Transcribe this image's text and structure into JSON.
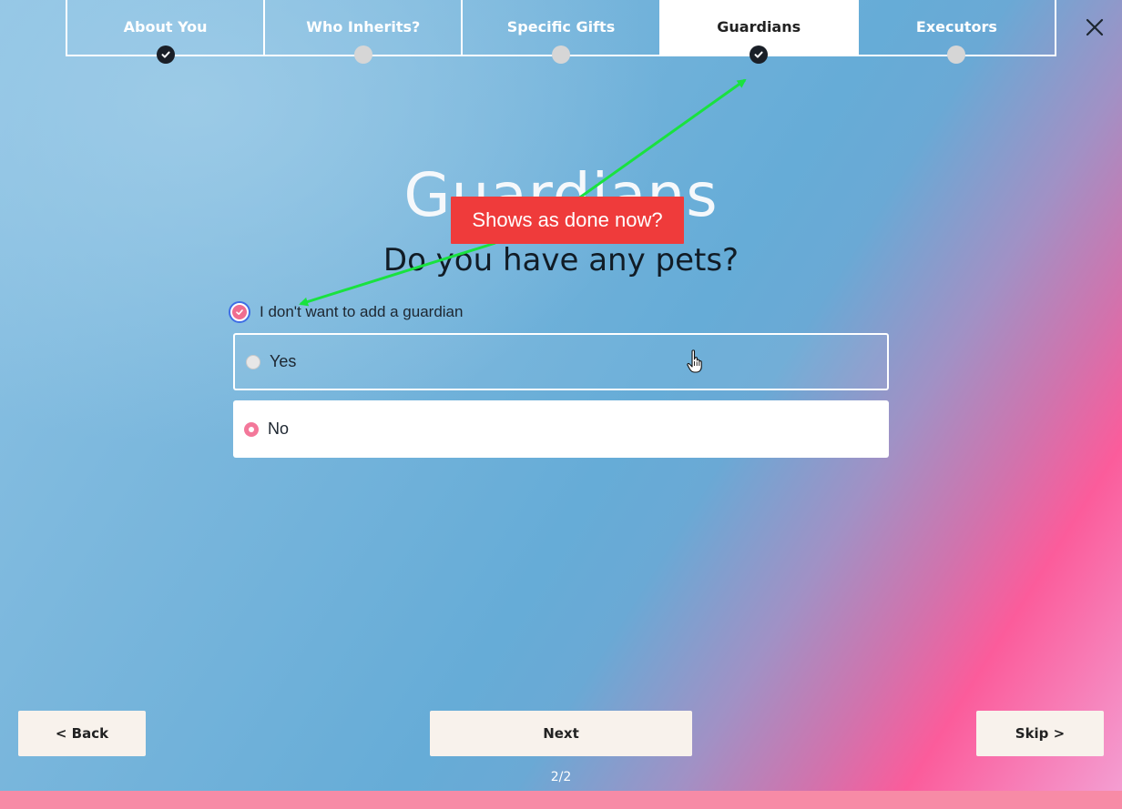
{
  "steps": [
    {
      "label": "About You",
      "state": "done"
    },
    {
      "label": "Who Inherits?",
      "state": "pending"
    },
    {
      "label": "Specific Gifts",
      "state": "pending"
    },
    {
      "label": "Guardians",
      "state": "done",
      "active": true
    },
    {
      "label": "Executors",
      "state": "pending"
    }
  ],
  "close_icon": "close-icon",
  "section_title": "Guardians",
  "question": "Do you have any pets?",
  "optout": {
    "label": "I don't want to add a guardian",
    "checked": true
  },
  "options": [
    {
      "label": "Yes",
      "selected": false
    },
    {
      "label": "No",
      "selected": true
    }
  ],
  "buttons": {
    "back": "< Back",
    "next": "Next",
    "skip": "Skip >"
  },
  "page_counter": "2/2",
  "progress": 1.0,
  "annotation": {
    "text": "Shows as done now?",
    "color": "#ef3b3b",
    "arrow_color": "#19e23f"
  },
  "colors": {
    "accent_pink": "#f3789a",
    "button_bg": "#f8f2ec",
    "done_dot": "#1a1f27"
  }
}
